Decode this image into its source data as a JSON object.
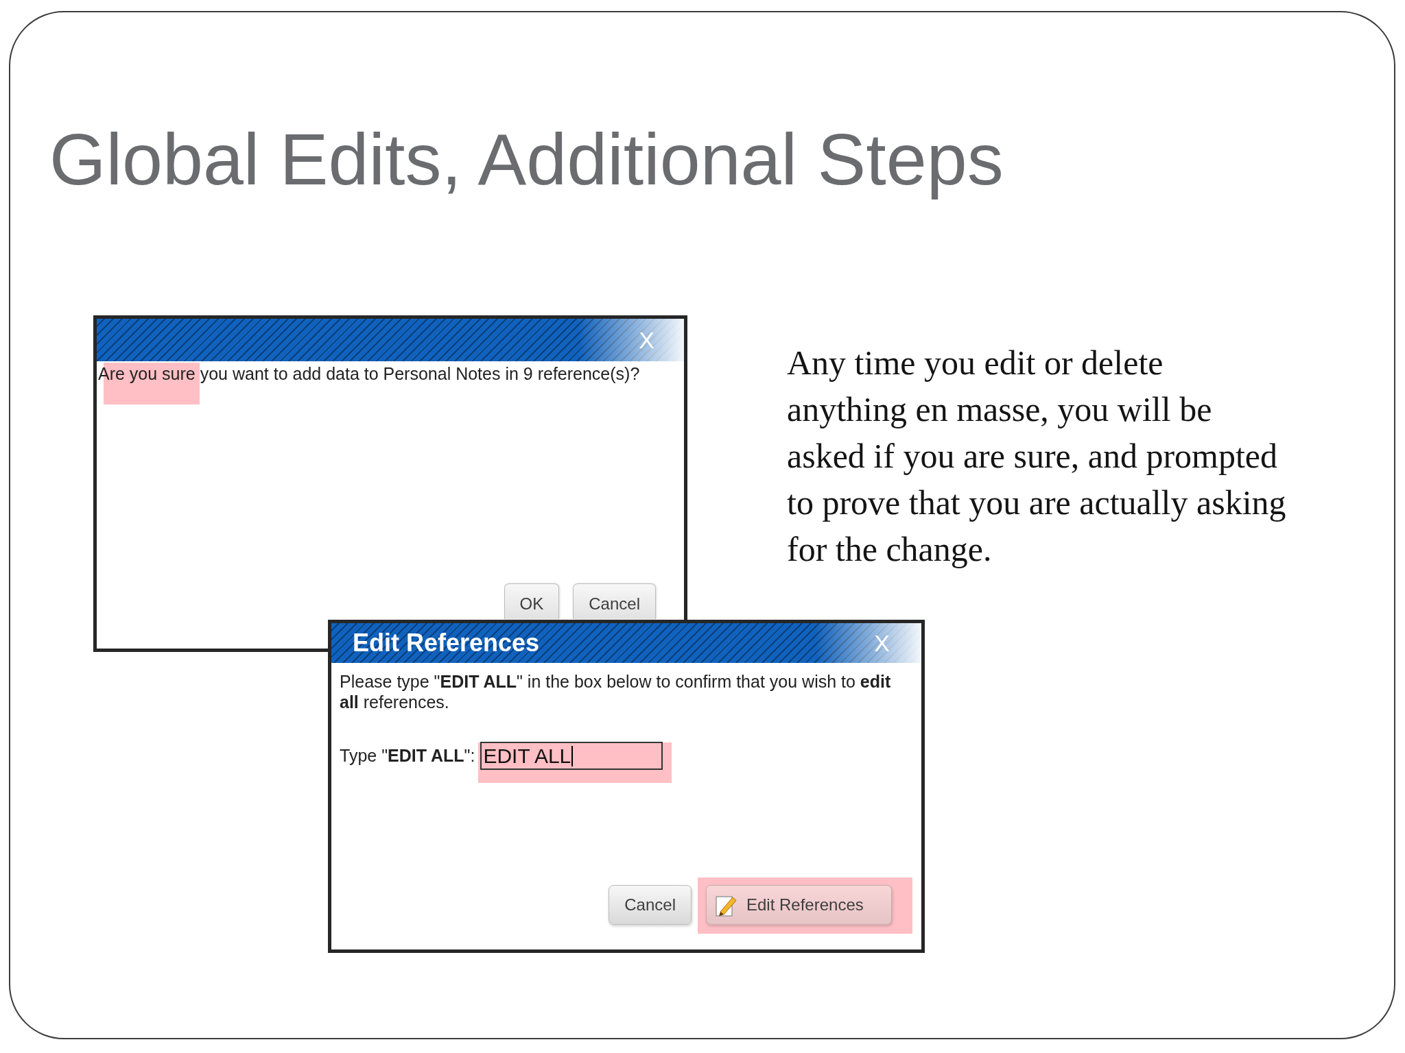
{
  "slide": {
    "title": "Global Edits, Additional Steps",
    "text": "Any time you edit or delete anything en masse, you will be asked if you are sure, and prompted to prove that you are actually asking for the change."
  },
  "dialogs": [
    {
      "close": "X",
      "message": {
        "text": "Are you sure you want to add data to Personal Notes in 9 reference(s)?",
        "highlighted": true
      },
      "buttons": [
        {
          "kind": "text",
          "label": "OK",
          "highlighted": false
        },
        {
          "kind": "text",
          "label": "Cancel",
          "highlighted": false
        }
      ]
    },
    {
      "title": "Edit References",
      "close": "X",
      "message": {
        "text": "Please type \"**EDIT ALL**\" in the box below to confirm that you wish to **edit all** references.",
        "highlighted": false
      },
      "field": {
        "label": "Type \"**EDIT ALL**\":",
        "value": "EDIT ALL",
        "focused": true,
        "highlighted": true
      },
      "buttons": [
        {
          "kind": "text",
          "label": "Cancel",
          "highlighted": false
        },
        {
          "kind": "icon",
          "label": "Edit References",
          "highlighted": true
        }
      ]
    }
  ]
}
